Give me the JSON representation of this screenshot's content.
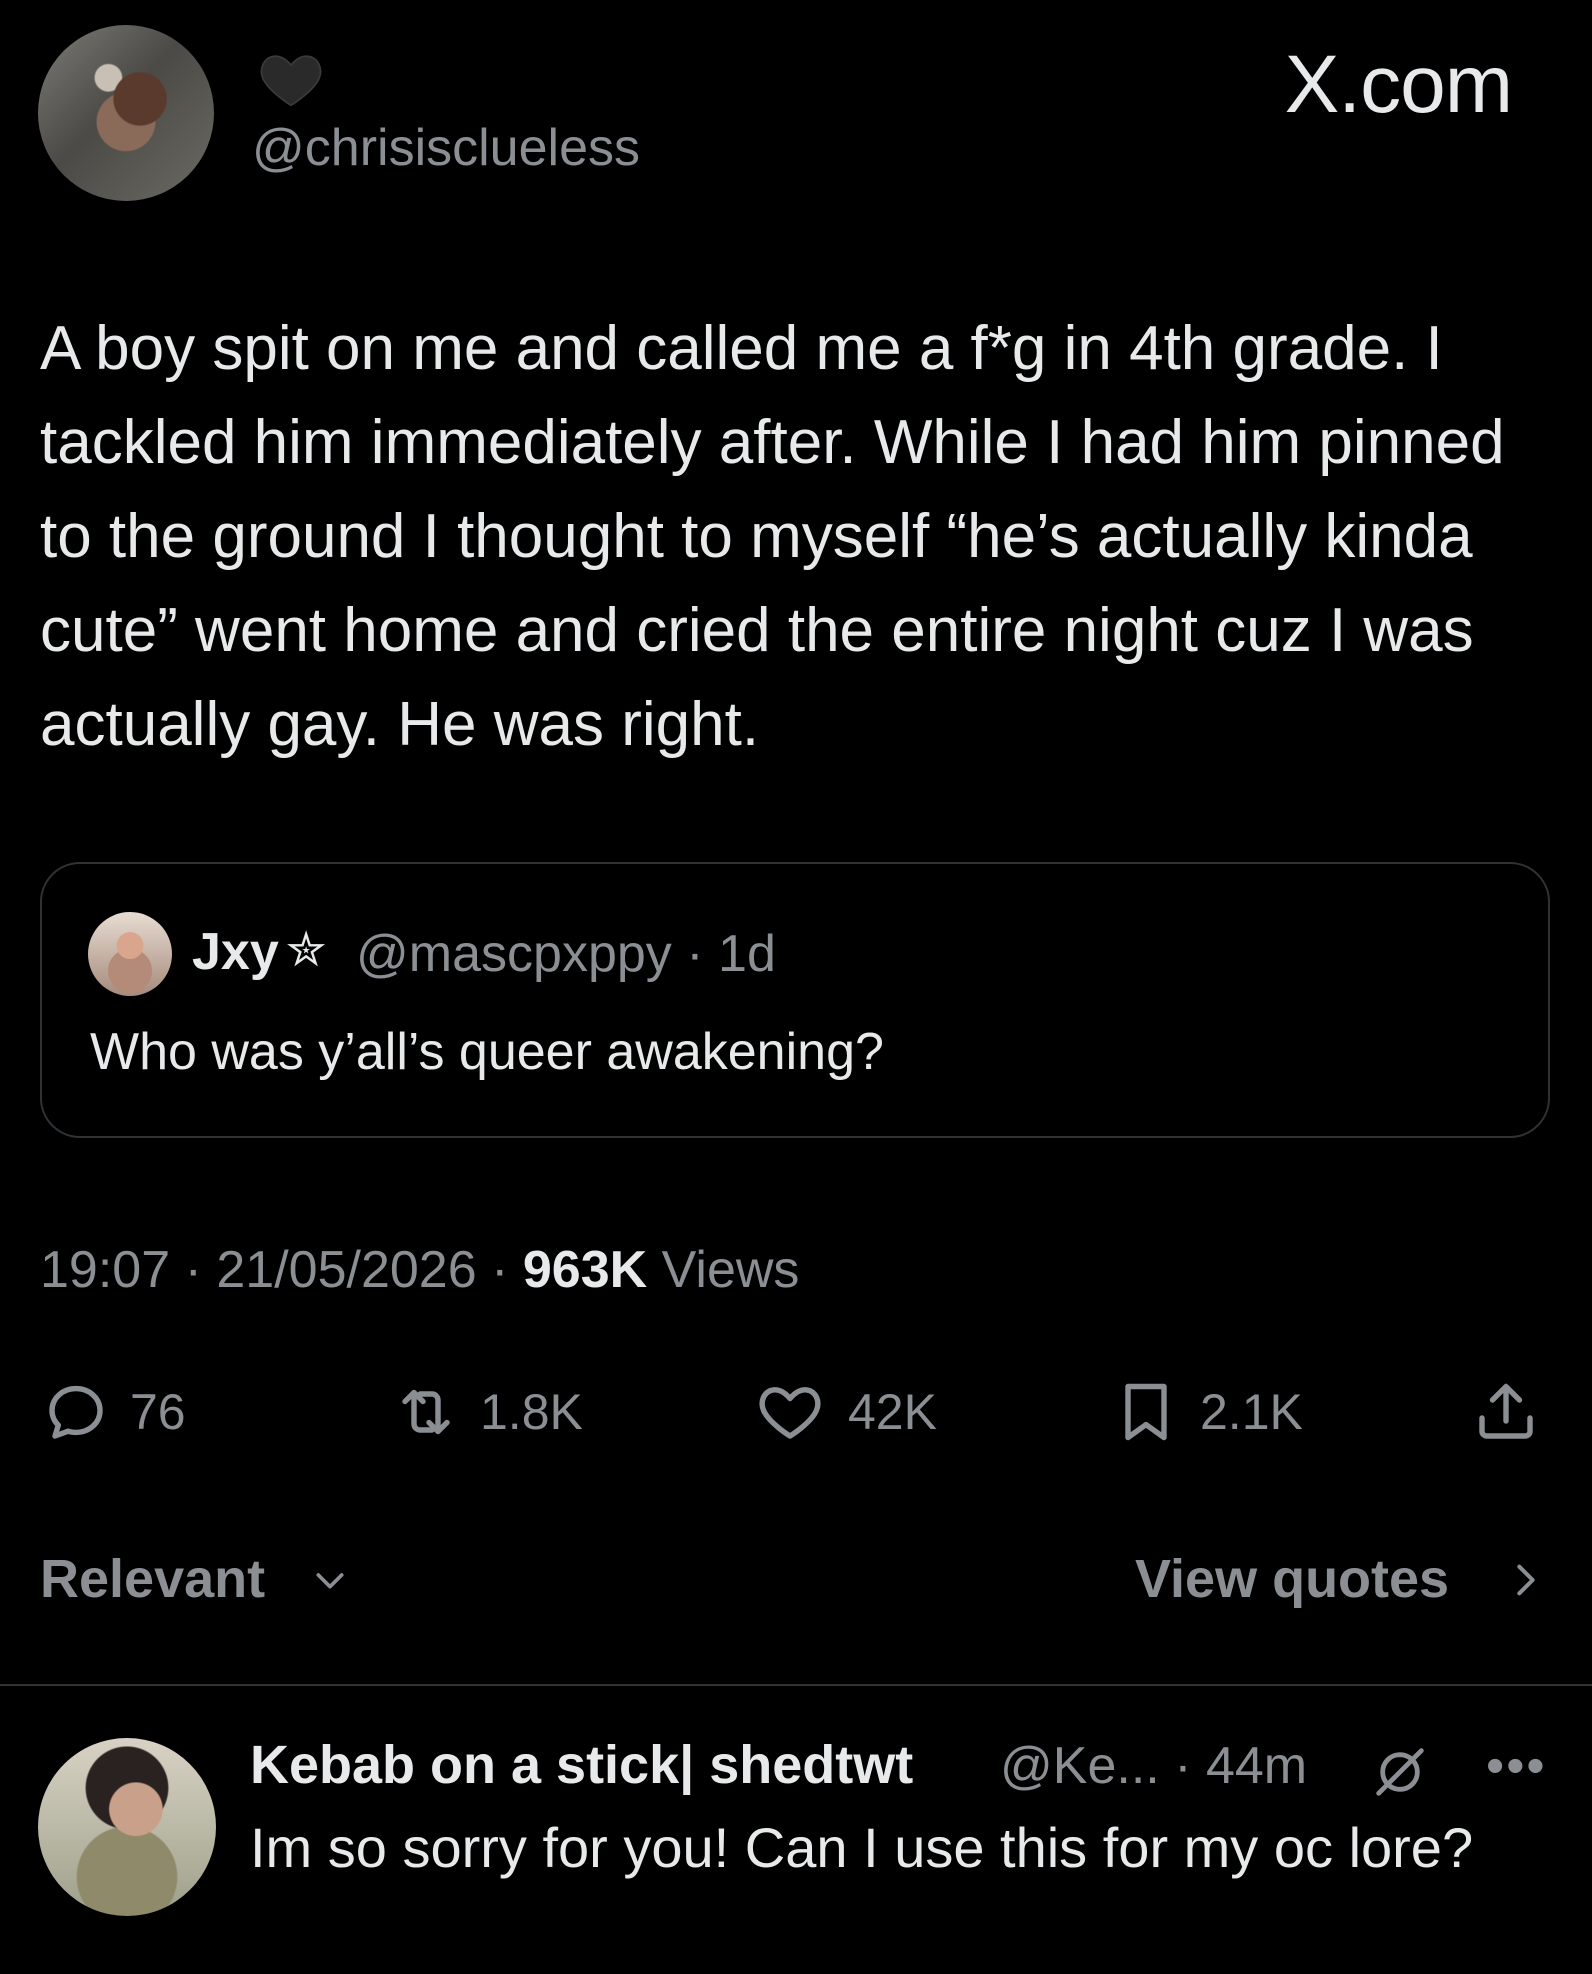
{
  "header": {
    "handle": "@chrisisclueless",
    "emoji_icon": "black-heart-icon",
    "brand": "X.com"
  },
  "tweet": {
    "text": "A boy spit on me and called me a f*g in 4th grade. I tackled him immediately after. While I had him pinned to the ground I thought to myself “he’s actually kinda cute” went home and cried the entire night cuz I was actually gay. He was right.",
    "time": "19:07",
    "date": "21/05/2026",
    "views_count": "963K",
    "views_label": "Views",
    "separator": "·"
  },
  "quote": {
    "name": "Jxy",
    "star": "✮",
    "handle": "@mascpxppy",
    "age": "1d",
    "text": "Who was y’all’s queer awakening?"
  },
  "actions": {
    "replies": "76",
    "reposts": "1.8K",
    "likes": "42K",
    "bookmarks": "2.1K"
  },
  "sort": {
    "relevant": "Relevant",
    "view_quotes": "View quotes"
  },
  "reply": {
    "name": "Kebab on a stick| shedtwt",
    "handle": "@Ke...",
    "age": "44m",
    "text": "Im so sorry for you! Can I use this for my oc lore?",
    "more": "•••"
  },
  "colors": {
    "background": "#000000",
    "text_primary": "#e7e9ea",
    "text_secondary": "#8b8f94",
    "border": "#2f3336"
  }
}
